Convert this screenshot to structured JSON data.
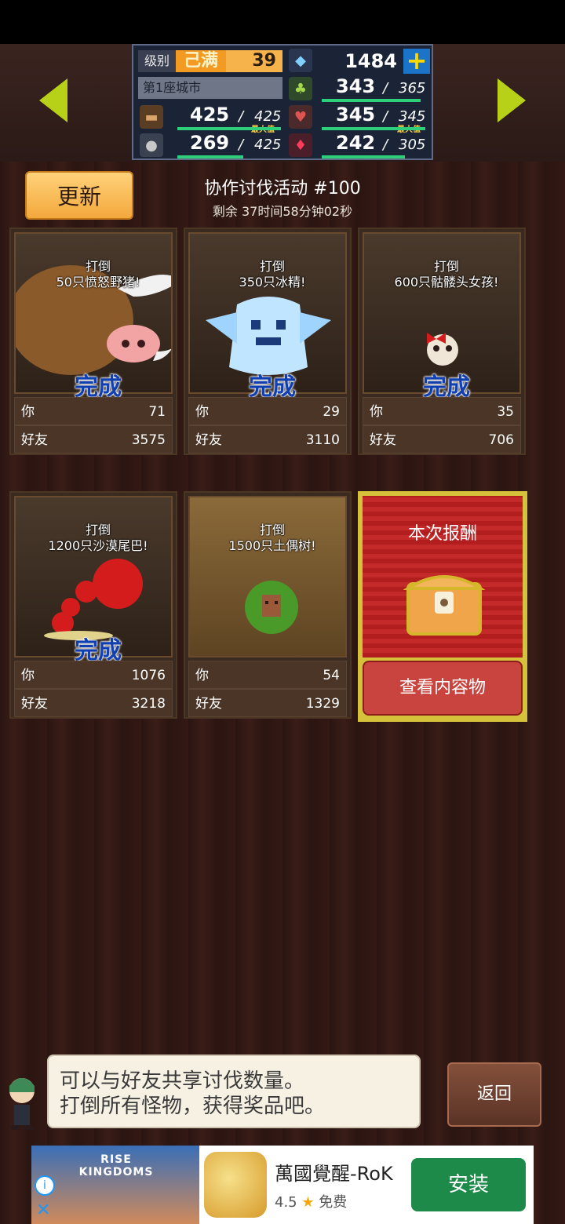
{
  "hud": {
    "level_label": "级别",
    "level_status": "己满",
    "level_value": "39",
    "city_name": "第1座城市",
    "gems": "1484",
    "plus_symbol": "+",
    "resources": {
      "wood": {
        "current": "425",
        "sep": "/",
        "max": "425",
        "max_label": "最大值"
      },
      "grass": {
        "current": "343",
        "sep": "/",
        "max": "365"
      },
      "food": {
        "current": "345",
        "sep": "/",
        "max": "345",
        "max_label": "最大值"
      },
      "stone": {
        "current": "269",
        "sep": "/",
        "max": "425"
      },
      "ruby": {
        "current": "242",
        "sep": "/",
        "max": "305"
      }
    }
  },
  "header": {
    "refresh_label": "更新",
    "event_title": "协作讨伐活动 #100",
    "timer": "剩余 37时间58分钟02秒"
  },
  "quests": [
    {
      "line1": "打倒",
      "line2": "50只愤怒野猪!",
      "status": "完成",
      "you_label": "你",
      "you": "71",
      "friend_label": "好友",
      "friend": "3575"
    },
    {
      "line1": "打倒",
      "line2": "350只冰精!",
      "status": "完成",
      "you_label": "你",
      "you": "29",
      "friend_label": "好友",
      "friend": "3110"
    },
    {
      "line1": "打倒",
      "line2": "600只骷髅头女孩!",
      "status": "完成",
      "you_label": "你",
      "you": "35",
      "friend_label": "好友",
      "friend": "706"
    },
    {
      "line1": "打倒",
      "line2": "1200只沙漠尾巴!",
      "status": "完成",
      "you_label": "你",
      "you": "1076",
      "friend_label": "好友",
      "friend": "3218"
    },
    {
      "line1": "打倒",
      "line2": "1500只土偶树!",
      "status": "",
      "you_label": "你",
      "you": "54",
      "friend_label": "好友",
      "friend": "1329"
    }
  ],
  "reward": {
    "title": "本次报酬",
    "view_label": "查看内容物"
  },
  "dialog": {
    "line1": "可以与好友共享讨伐数量。",
    "line2": "打倒所有怪物，获得奖品吧。",
    "back_label": "返回"
  },
  "ad": {
    "logo": "RISE KINGDOMS",
    "app_name": "萬國覺醒-RoK",
    "rating": "4.5",
    "star": "★",
    "price": "免费",
    "install_label": "安装",
    "info_symbol": "i",
    "close_symbol": "✕"
  }
}
